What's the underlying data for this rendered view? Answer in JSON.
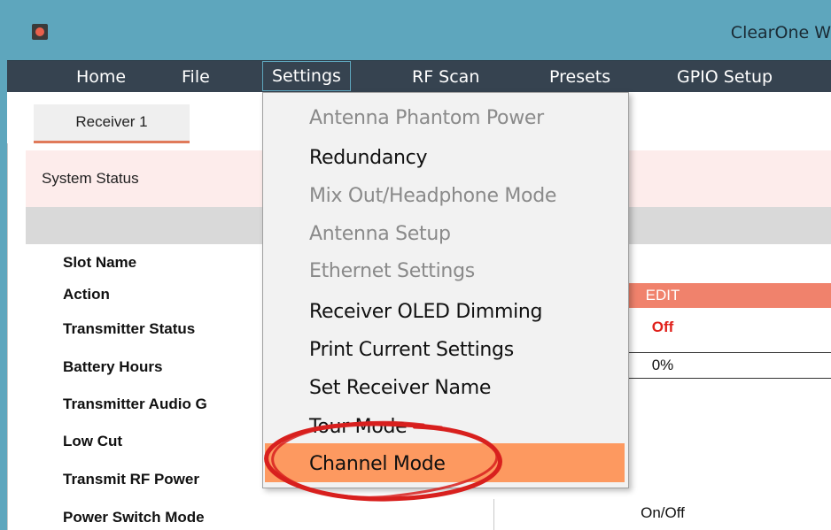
{
  "window": {
    "title": "ClearOne W"
  },
  "menubar": {
    "items": [
      {
        "label": "Home"
      },
      {
        "label": "File"
      },
      {
        "label": "Settings"
      },
      {
        "label": "RF Scan"
      },
      {
        "label": "Presets"
      },
      {
        "label": "GPIO Setup"
      }
    ]
  },
  "tabs": [
    {
      "label": "Receiver 1"
    }
  ],
  "system_status": {
    "label": "System Status"
  },
  "rows": [
    {
      "label": "Slot Name"
    },
    {
      "label": "Action"
    },
    {
      "label": "Transmitter Status"
    },
    {
      "label": "Battery Hours"
    },
    {
      "label": "Transmitter Audio G"
    },
    {
      "label": "Low Cut"
    },
    {
      "label": "Transmit RF Power"
    },
    {
      "label": "Power Switch Mode"
    }
  ],
  "values": {
    "action": "EDIT",
    "transmitter_status": "Off",
    "battery_hours": "0%",
    "power_switch_mode": "On/Off"
  },
  "settings_menu": {
    "items": [
      {
        "label": "Antenna Phantom Power",
        "enabled": false
      },
      {
        "label": "Redundancy",
        "enabled": true
      },
      {
        "label": "Mix Out/Headphone Mode",
        "enabled": false
      },
      {
        "label": "Antenna Setup",
        "enabled": false
      },
      {
        "label": "Ethernet Settings",
        "enabled": false
      },
      {
        "label": "Receiver OLED Dimming",
        "enabled": true
      },
      {
        "label": "Print Current Settings",
        "enabled": true
      },
      {
        "label": "Set Receiver Name",
        "enabled": true
      },
      {
        "label": "Tour Mode",
        "enabled": true
      },
      {
        "label": "Channel Mode",
        "enabled": true,
        "highlighted": true
      }
    ]
  },
  "colors": {
    "titlebar": "#5ea6bd",
    "menubar": "#364350",
    "highlight": "#fd9960",
    "edit": "#f0826c",
    "status_off": "#e0201a",
    "annotation_circle": "#d8201e"
  }
}
